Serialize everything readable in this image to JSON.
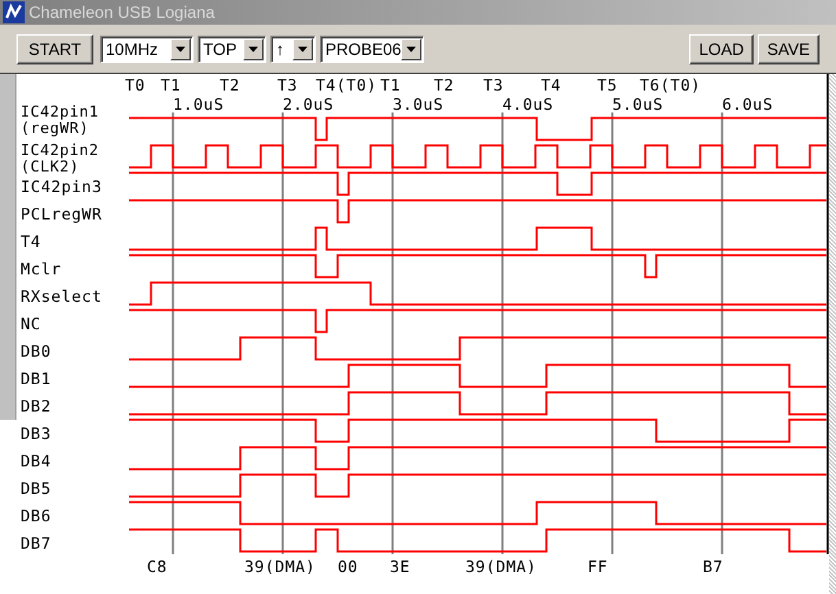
{
  "window": {
    "title": "Chameleon USB Logiana"
  },
  "toolbar": {
    "start_button": "START",
    "dropdowns": [
      {
        "value": "10MHz"
      },
      {
        "value": "TOP"
      },
      {
        "value": "↑"
      },
      {
        "value": "PROBE06"
      }
    ],
    "buttons": [
      "LOAD",
      "SAVE"
    ]
  },
  "phase_labels": [
    "T0",
    "T1",
    "T2",
    "T3",
    "T4(T0)",
    "T1",
    "T2",
    "T3",
    "T4",
    "T5",
    "T6(T0)"
  ],
  "time_labels": [
    "1.0uS",
    "2.0uS",
    "3.0uS",
    "4.0uS",
    "5.0uS",
    "6.0uS"
  ],
  "signals": [
    {
      "name": [
        "IC42pin1",
        "(regWR)"
      ]
    },
    {
      "name": [
        "IC42pin2",
        "(CLK2)"
      ]
    },
    {
      "name": [
        "IC42pin3"
      ]
    },
    {
      "name": [
        "PCLregWR"
      ]
    },
    {
      "name": [
        "T4"
      ]
    },
    {
      "name": [
        "Mclr"
      ]
    },
    {
      "name": [
        "RXselect"
      ]
    },
    {
      "name": [
        "NC"
      ]
    },
    {
      "name": [
        "DB0"
      ]
    },
    {
      "name": [
        "DB1"
      ]
    },
    {
      "name": [
        "DB2"
      ]
    },
    {
      "name": [
        "DB3"
      ]
    },
    {
      "name": [
        "DB4"
      ]
    },
    {
      "name": [
        "DB5"
      ]
    },
    {
      "name": [
        "DB6"
      ]
    },
    {
      "name": [
        "DB7"
      ]
    }
  ],
  "bus_values": [
    "C8",
    "39(DMA)",
    "00",
    "3E",
    "39(DMA)",
    "FF",
    "B7"
  ]
}
